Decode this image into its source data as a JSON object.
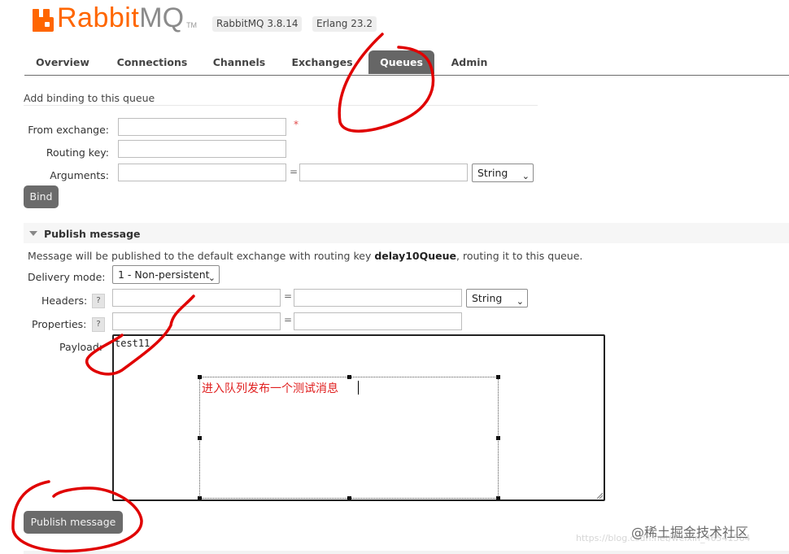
{
  "header": {
    "logo_rabbit": "Rabbit",
    "logo_mq": "MQ",
    "logo_tm": "TM",
    "rabbitmq_version": "RabbitMQ 3.8.14",
    "erlang_version": "Erlang 23.2"
  },
  "tabs": [
    {
      "label": "Overview",
      "active": false
    },
    {
      "label": "Connections",
      "active": false
    },
    {
      "label": "Channels",
      "active": false
    },
    {
      "label": "Exchanges",
      "active": false
    },
    {
      "label": "Queues",
      "active": true
    },
    {
      "label": "Admin",
      "active": false
    }
  ],
  "binding": {
    "title": "Add binding to this queue",
    "from_exchange_label": "From exchange:",
    "from_exchange_value": "",
    "required_mark": "*",
    "routing_key_label": "Routing key:",
    "routing_key_value": "",
    "arguments_label": "Arguments:",
    "arguments_key": "",
    "equals": "=",
    "arguments_value": "",
    "arguments_type": "String",
    "bind_button": "Bind"
  },
  "publish": {
    "section_title": "Publish message",
    "info_prefix": "Message will be published to the default exchange with routing key ",
    "routing_key": "delay10Queue",
    "info_suffix": ", routing it to this queue.",
    "delivery_mode_label": "Delivery mode:",
    "delivery_mode_value": "1 - Non-persistent",
    "headers_label": "Headers:",
    "headers_help": "?",
    "headers_type": "String",
    "properties_label": "Properties:",
    "properties_help": "?",
    "equals": "=",
    "payload_label": "Payload:",
    "payload_value": "test11",
    "publish_button": "Publish message"
  },
  "annotation": {
    "text": "进入队列发布一个测试消息",
    "color": "#e02020"
  },
  "watermark": {
    "line1": "@稀土掘金技术社区",
    "line2": "https://blog.csdn.net/weixin_46541564"
  },
  "colors": {
    "brand_orange": "#ff6600",
    "tab_active_bg": "#666666",
    "button_bg": "#6b6b6b",
    "scribble_red": "#e00000"
  }
}
